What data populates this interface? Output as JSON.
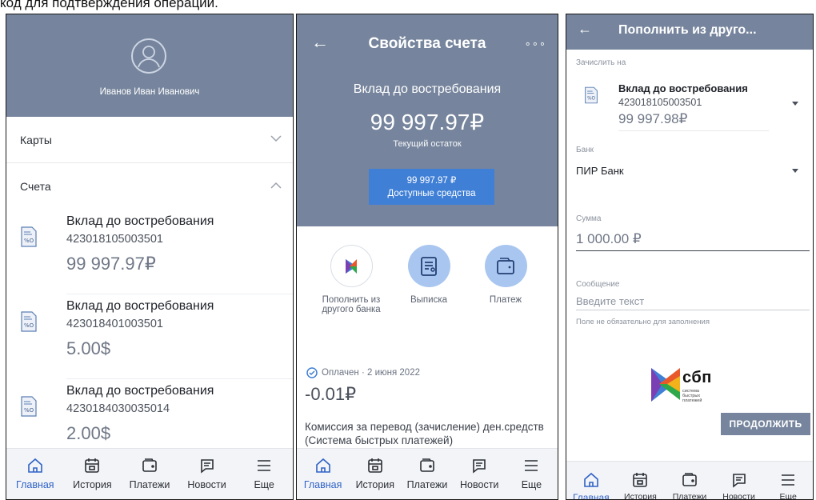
{
  "caption": "код для подтверждения операции.",
  "tabs": [
    {
      "label": "Главная",
      "icon": "home-icon"
    },
    {
      "label": "История",
      "icon": "calendar-icon"
    },
    {
      "label": "Платежи",
      "icon": "wallet-icon"
    },
    {
      "label": "Новости",
      "icon": "message-icon"
    },
    {
      "label": "Еще",
      "icon": "menu-icon"
    }
  ],
  "colors": {
    "header": "#76859d",
    "accent": "#2f62c7",
    "button": "#3f7fd5",
    "actionCircle": "#a9c6f0"
  },
  "screen1": {
    "user_name": "Иванов Иван Иванович",
    "sections": {
      "cards": "Карты",
      "accounts": "Счета"
    },
    "accounts": [
      {
        "name": "Вклад до востребования",
        "number": "423018105003501",
        "balance": "99 997.97₽"
      },
      {
        "name": "Вклад до востребования",
        "number": "423018401003501",
        "balance": "5.00$"
      },
      {
        "name": "Вклад до востребования",
        "number": "4230184030035014",
        "balance": "2.00$"
      }
    ]
  },
  "screen2": {
    "title": "Свойства счета",
    "more": "∘∘∘",
    "account_name": "Вклад до востребования",
    "balance": "99 997.97₽",
    "balance_caption": "Текущий остаток",
    "available_amount": "99 997.97 ₽",
    "available_label": "Доступные средства",
    "actions": [
      {
        "label": "Пополнить из другого банка",
        "icon": "sbp-icon"
      },
      {
        "label": "Выписка",
        "icon": "statement-icon"
      },
      {
        "label": "Платеж",
        "icon": "wallet-icon"
      }
    ],
    "transaction": {
      "status": "Оплачен · 2 июня 2022",
      "amount": "-0.01₽",
      "description": "Комиссия за перевод (зачисление) ден.средств (Система быстрых платежей)"
    }
  },
  "screen3": {
    "title": "Пополнить из друго...",
    "credit_to_label": "Зачислить на",
    "account_name": "Вклад до востребования",
    "account_number": "423018105003501",
    "account_balance": "99 997.98₽",
    "bank_label": "Банк",
    "bank_value": "ПИР Банк",
    "amount_label": "Сумма",
    "amount_value": "1 000.00 ₽",
    "message_label": "Сообщение",
    "message_placeholder": "Введите текст",
    "message_hint": "Поле не обязательно для заполнения",
    "sbp_logo_text": "сбп",
    "sbp_logo_subtext": "система быстрых платежей",
    "continue_button": "ПРОДОЛЖИТЬ"
  }
}
